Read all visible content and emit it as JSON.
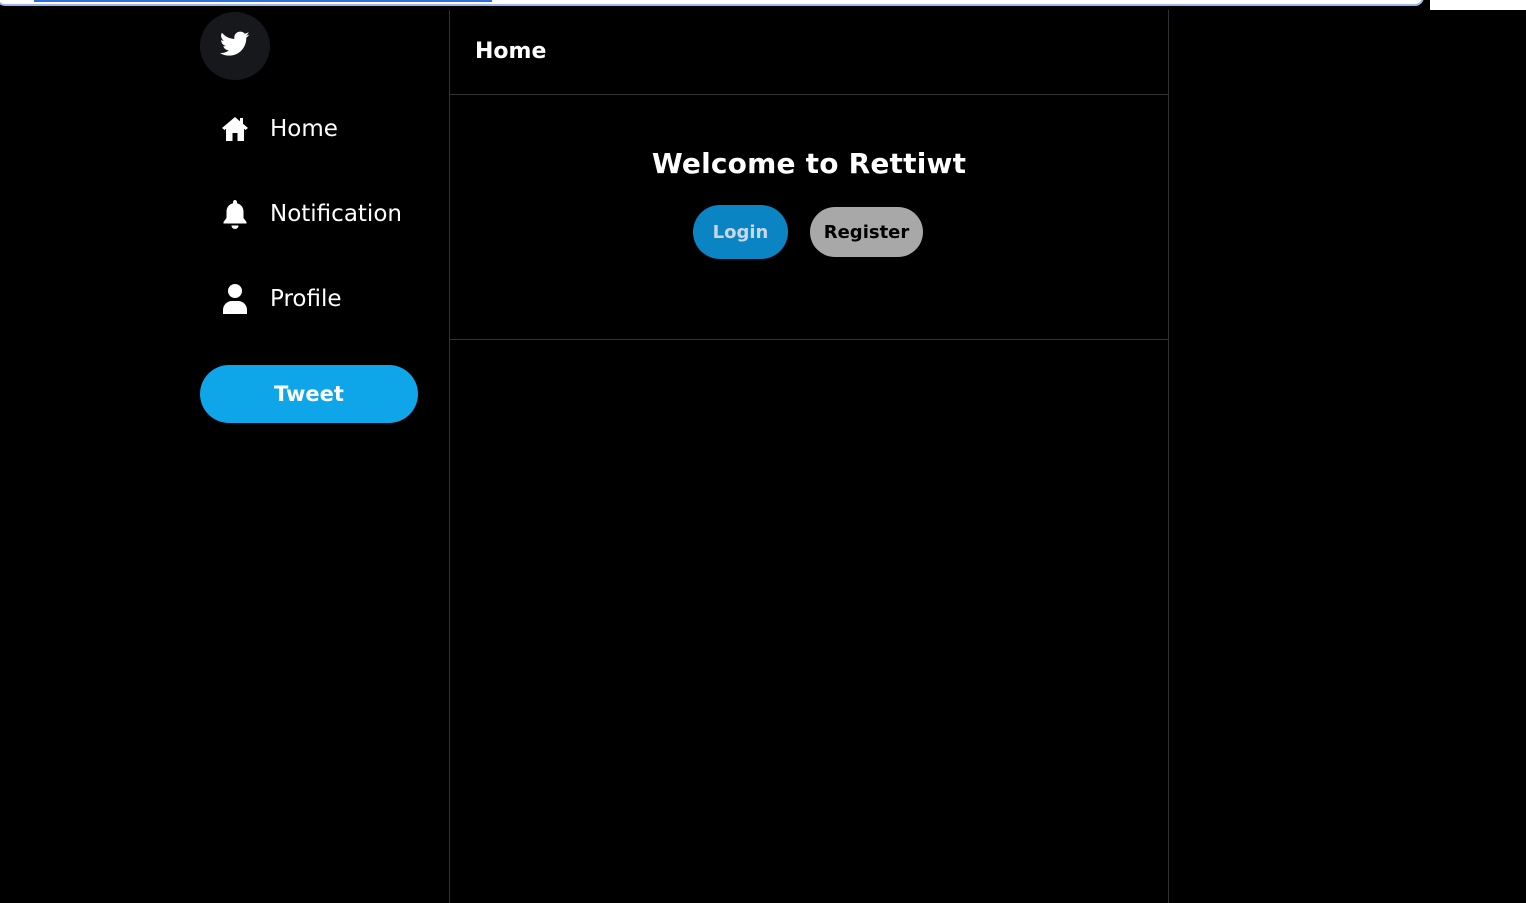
{
  "sidebar": {
    "logo_icon": "twitter-bird-icon",
    "items": [
      {
        "label": "Home",
        "icon": "home-icon"
      },
      {
        "label": "Notification",
        "icon": "bell-icon"
      },
      {
        "label": "Profile",
        "icon": "user-icon"
      }
    ],
    "tweet_label": "Tweet"
  },
  "header": {
    "title": "Home"
  },
  "welcome": {
    "heading": "Welcome to Rettiwt",
    "login_label": "Login",
    "register_label": "Register"
  },
  "colors": {
    "background": "#000000",
    "accent": "#0ea5e9",
    "login": "#0a84c2",
    "register": "#a8a8a8",
    "divider": "#2f3336"
  }
}
